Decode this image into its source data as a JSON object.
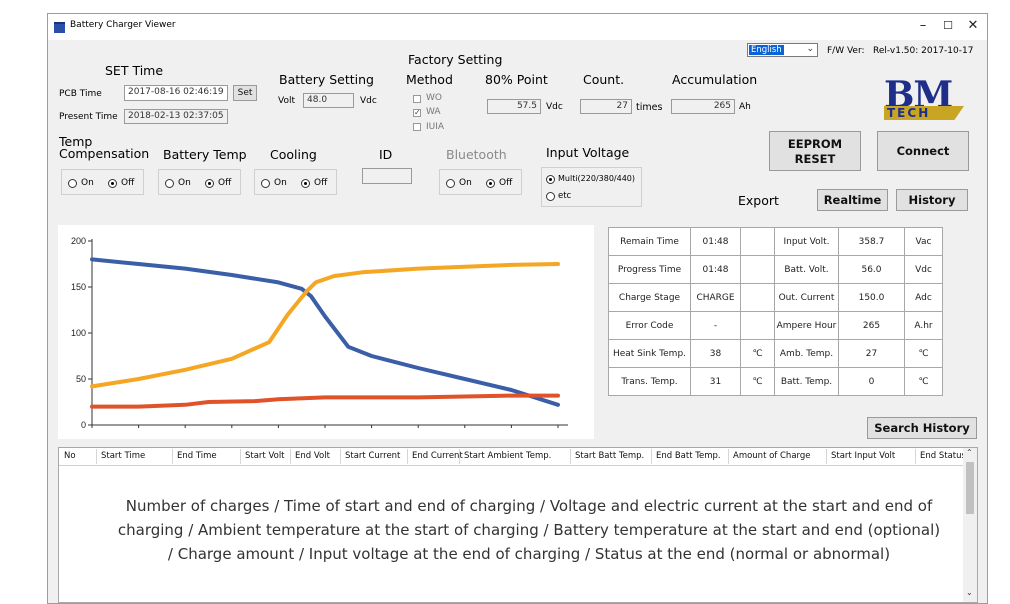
{
  "window": {
    "title": "Battery Charger Viewer",
    "minimize": "–",
    "maximize": "☐",
    "close": "✕"
  },
  "set_time": {
    "header": "SET Time",
    "pcb_label": "PCB Time",
    "pcb_value": "2017-08-16 02:46:19",
    "set_button": "Set",
    "present_label": "Present Time",
    "present_value": "2018-02-13 02:37:05"
  },
  "battery_setting": {
    "header": "Battery Setting",
    "volt_label": "Volt",
    "volt_value": "48.0",
    "volt_unit": "Vdc"
  },
  "factory_setting": {
    "header": "Factory Setting",
    "method_header": "Method",
    "methods": [
      {
        "label": "WO",
        "checked": false
      },
      {
        "label": "WA",
        "checked": true
      },
      {
        "label": "IUIA",
        "checked": false
      }
    ],
    "point_header": "80% Point",
    "point_value": "57.5",
    "point_unit": "Vdc",
    "count_header": "Count.",
    "count_value": "27",
    "count_unit": "times",
    "accum_header": "Accumulation",
    "accum_value": "265",
    "accum_unit": "Ah"
  },
  "language": {
    "selected": "English"
  },
  "firmware": {
    "label": "F/W Ver:",
    "value": "Rel-v1.50: 2017-10-17"
  },
  "logo": {
    "text": "BM",
    "sub": "TECH",
    "color_blue": "#1e2f8a",
    "color_gold": "#c8a623"
  },
  "buttons": {
    "eeprom_line1": "EEPROM",
    "eeprom_line2": "RESET",
    "connect": "Connect",
    "export_label": "Export",
    "realtime": "Realtime",
    "history": "History",
    "search_history": "Search History"
  },
  "temp_comp": {
    "header_line1": "Temp",
    "header_line2": "Compensation",
    "on": "On",
    "off": "Off",
    "selected": "Off"
  },
  "battery_temp": {
    "header": "Battery Temp",
    "on": "On",
    "off": "Off",
    "selected": "Off"
  },
  "cooling": {
    "header": "Cooling",
    "on": "On",
    "off": "Off",
    "selected": "Off"
  },
  "id": {
    "header": "ID",
    "value": ""
  },
  "bluetooth": {
    "header": "Bluetooth",
    "on": "On",
    "off": "Off",
    "selected": "Off"
  },
  "input_voltage": {
    "header": "Input Voltage",
    "options": [
      "Multi(220/380/440)",
      "etc"
    ],
    "selected": "Multi(220/380/440)"
  },
  "status_table": {
    "rows": [
      {
        "l1": "Remain Time",
        "v1": "01:48",
        "u1": "",
        "l2": "Input Volt.",
        "v2": "358.7",
        "u2": "Vac"
      },
      {
        "l1": "Progress Time",
        "v1": "01:48",
        "u1": "",
        "l2": "Batt. Volt.",
        "v2": "56.0",
        "u2": "Vdc"
      },
      {
        "l1": "Charge Stage",
        "v1": "CHARGE",
        "u1": "",
        "l2": "Out. Current",
        "v2": "150.0",
        "u2": "Adc"
      },
      {
        "l1": "Error Code",
        "v1": "-",
        "u1": "",
        "l2": "Ampere Hour",
        "v2": "265",
        "u2": "A.hr"
      },
      {
        "l1": "Heat Sink Temp.",
        "v1": "38",
        "u1": "℃",
        "l2": "Amb. Temp.",
        "v2": "27",
        "u2": "℃"
      },
      {
        "l1": "Trans. Temp.",
        "v1": "31",
        "u1": "℃",
        "l2": "Batt. Temp.",
        "v2": "0",
        "u2": "℃"
      }
    ]
  },
  "chart_data": {
    "type": "line",
    "title": "",
    "xlabel": "",
    "ylabel": "",
    "ylim": [
      0,
      200
    ],
    "xlim": [
      0,
      100
    ],
    "yticks": [
      0,
      50,
      100,
      150,
      200
    ],
    "grid": false,
    "series": [
      {
        "color": "#3a5ea8",
        "x": [
          0,
          10,
          20,
          30,
          40,
          45,
          47,
          50,
          55,
          60,
          70,
          80,
          90,
          100
        ],
        "y": [
          180,
          175,
          170,
          163,
          155,
          148,
          140,
          118,
          85,
          75,
          62,
          50,
          38,
          22
        ]
      },
      {
        "color": "#f5a623",
        "x": [
          0,
          10,
          20,
          30,
          38,
          42,
          46,
          48,
          52,
          58,
          70,
          80,
          90,
          100
        ],
        "y": [
          42,
          50,
          60,
          72,
          90,
          120,
          145,
          155,
          162,
          166,
          170,
          172,
          174,
          175
        ]
      },
      {
        "color": "#e0522a",
        "x": [
          0,
          10,
          20,
          25,
          35,
          40,
          50,
          60,
          70,
          80,
          90,
          100
        ],
        "y": [
          20,
          20,
          22,
          25,
          26,
          28,
          30,
          30,
          30,
          31,
          32,
          32
        ]
      }
    ]
  },
  "history_table": {
    "columns": [
      "No",
      "Start Time",
      "End Time",
      "Start Volt",
      "End Volt",
      "Start Current",
      "End Current",
      "Start Ambient Temp.",
      "Start Batt Temp.",
      "End Batt Temp.",
      "Amount of Charge",
      "Start Input Volt",
      "End Status"
    ],
    "note_lines": [
      "Number of charges / Time of start and end of charging / Voltage and electric current at the start and end of",
      "charging / Ambient temperature at the start of charging / Battery temperature at the start and end (optional)",
      "/ Charge amount / Input voltage at the end of charging / Status at the end (normal or abnormal)"
    ]
  }
}
